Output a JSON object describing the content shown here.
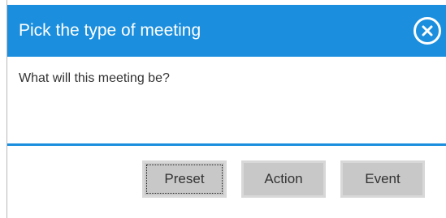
{
  "dialog": {
    "title": "Pick the type of meeting",
    "message": "What will this meeting be?",
    "close_icon": "close-circle-icon",
    "buttons": [
      {
        "label": "Preset",
        "focused": true
      },
      {
        "label": "Action",
        "focused": false
      },
      {
        "label": "Event",
        "focused": false
      }
    ]
  },
  "colors": {
    "accent": "#1b8fde",
    "button_bg": "#c8c8c8",
    "title_text": "#ffffff"
  }
}
